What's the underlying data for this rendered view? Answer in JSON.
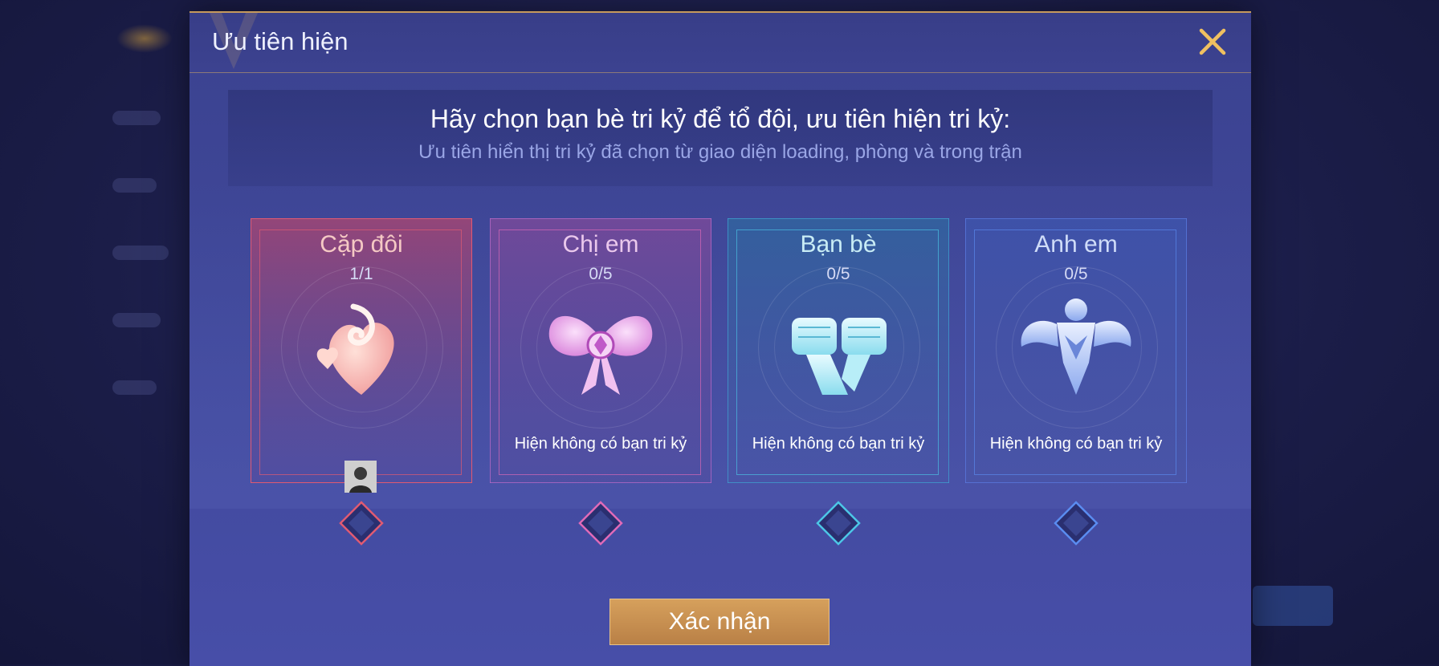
{
  "dialog": {
    "title": "Ưu tiên hiện",
    "close_icon": "close-icon",
    "headline": "Hãy chọn bạn bè tri kỷ để tổ đội, ưu tiên hiện tri kỷ:",
    "subline": "Ưu tiên hiển thị tri kỷ đã chọn từ giao diện loading, phòng và trong trận",
    "confirm_label": "Xác nhận"
  },
  "cards": [
    {
      "title": "Cặp đôi",
      "count": "1/1",
      "status": "",
      "icon": "heart-swirl-icon",
      "accent": "#e05a72",
      "title_color": "#f5c9c4",
      "has_avatar": true
    },
    {
      "title": "Chị em",
      "count": "0/5",
      "status": "Hiện không có bạn tri kỷ",
      "icon": "bow-icon",
      "accent": "#e06ab8",
      "title_color": "#eac8ec",
      "has_avatar": false
    },
    {
      "title": "Bạn bè",
      "count": "0/5",
      "status": "Hiện không có bạn tri kỷ",
      "icon": "fist-bump-icon",
      "accent": "#4cc6e6",
      "title_color": "#c8ecf5",
      "has_avatar": false
    },
    {
      "title": "Anh em",
      "count": "0/5",
      "status": "Hiện không có bạn tri kỷ",
      "icon": "muscle-icon",
      "accent": "#5a8cf0",
      "title_color": "#cfdcf8",
      "has_avatar": false
    }
  ],
  "colors": {
    "dialog_bg": "#3f4798",
    "header_border": "#c69a5c",
    "confirm_bg": "#c9914f",
    "close_color": "#f0c060"
  }
}
